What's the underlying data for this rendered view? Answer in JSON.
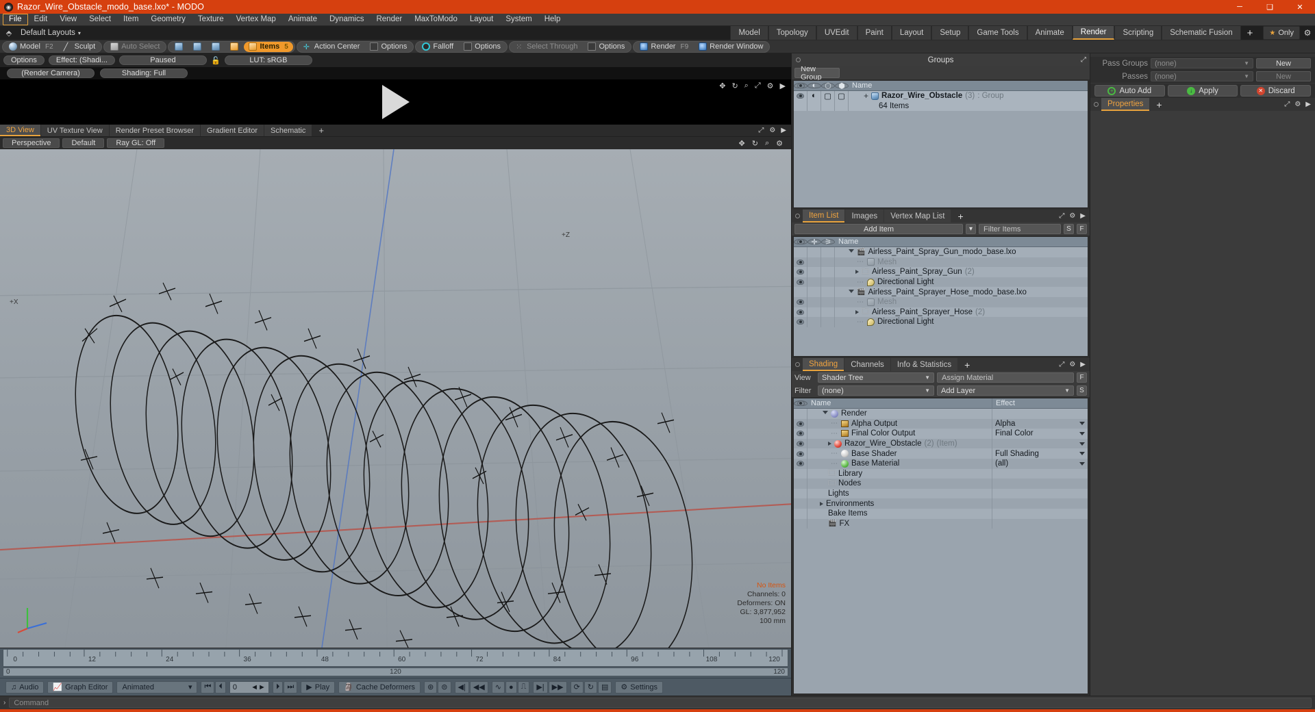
{
  "window": {
    "title": "Razor_Wire_Obstacle_modo_base.lxo* - MODO",
    "minimize": "─",
    "maximize": "❑",
    "close": "✕"
  },
  "menubar": {
    "items": [
      "File",
      "Edit",
      "View",
      "Select",
      "Item",
      "Geometry",
      "Texture",
      "Vertex Map",
      "Animate",
      "Dynamics",
      "Render",
      "MaxToModo",
      "Layout",
      "System",
      "Help"
    ],
    "active": "File"
  },
  "layout_row": {
    "layout_name": "Default Layouts",
    "caret": "▾",
    "tabs": [
      "Model",
      "Topology",
      "UVEdit",
      "Paint",
      "Layout",
      "Setup",
      "Game Tools",
      "Animate",
      "Render",
      "Scripting",
      "Schematic Fusion"
    ],
    "selected_tab": "Render",
    "add_tab": "+",
    "only_label": "Only",
    "star": "★"
  },
  "toolbar": {
    "mode_group": [
      {
        "label": "Model",
        "hotkey": "F2",
        "icon": "sphere-icon"
      },
      {
        "label": "Sculpt",
        "hotkey": "",
        "icon": "pen-icon"
      }
    ],
    "auto_select": "Auto Select",
    "select_modes": [
      "vertex-select-icon",
      "edge-select-icon",
      "polygon-select-icon",
      "material-select-icon"
    ],
    "items_label": "Items",
    "items_hotkey": "5",
    "action_center": "Action Center",
    "options1": "Options",
    "falloff": "Falloff",
    "options2": "Options",
    "select_through": "Select Through",
    "options3": "Options",
    "render": "Render",
    "render_hotkey": "F9",
    "render_window": "Render Window"
  },
  "preview": {
    "options": "Options",
    "effect": "Effect: (Shadi...",
    "paused": "Paused",
    "lut": "LUT: sRGB",
    "camera": "(Render Camera)",
    "shading": "Shading: Full",
    "icons": [
      "move-icon",
      "rotate-icon",
      "zoom-icon",
      "fit-icon",
      "gear-icon",
      "play-icon"
    ]
  },
  "viewport": {
    "tabs": [
      "3D View",
      "UV Texture View",
      "Render Preset Browser",
      "Gradient Editor",
      "Schematic"
    ],
    "selected_tab": "3D View",
    "add_tab": "+",
    "buttons": [
      "Perspective",
      "Default",
      "Ray GL: Off"
    ],
    "icons": [
      "move-icon",
      "rotate-icon",
      "zoom-icon",
      "gear-icon"
    ],
    "hud": {
      "no_items": "No Items",
      "channels": "Channels: 0",
      "deformers": "Deformers: ON",
      "gl": "GL: 3,877,952",
      "scale": "100 mm"
    },
    "axis_labels": {
      "plus_z": "+Z",
      "plus_x": "+X"
    }
  },
  "timeline": {
    "ticks": [
      "0",
      "12",
      "24",
      "36",
      "48",
      "60",
      "72",
      "84",
      "96",
      "108",
      "120"
    ],
    "range_start": "0",
    "range_mid": "120",
    "range_end": "120"
  },
  "bottombar": {
    "audio": "Audio",
    "graph_editor": "Graph Editor",
    "animated": "Animated",
    "caret": "▾",
    "frame_value": "0",
    "play": "Play",
    "cache_deformers": "Cache Deformers",
    "settings": "Settings",
    "transport": [
      "⏮",
      "⏴",
      "⏵",
      "⏭"
    ]
  },
  "groups_panel": {
    "title": "Groups",
    "new_group_button": "New Group",
    "columns": [
      "eye-icon",
      "shade-icon",
      "lock-icon",
      "render-icon",
      "Name"
    ],
    "rows": [
      {
        "name": "Razor_Wire_Obstacle",
        "count": "(3)",
        "type": ": Group",
        "sub": "64 Items"
      }
    ]
  },
  "item_list_panel": {
    "tabs": [
      "Item List",
      "Images",
      "Vertex Map List"
    ],
    "selected_tab": "Item List",
    "add_tab": "+",
    "add_item": "Add Item",
    "filter_placeholder": "Filter Items",
    "btn_s": "S",
    "btn_f": "F",
    "columns": [
      "eye-icon",
      "lock-icon",
      "axis-icon",
      "Name"
    ],
    "rows": [
      {
        "indent": 0,
        "name": "Airless_Paint_Spray_Gun_modo_base.lxo",
        "icon": "scene-icon",
        "tri": "down",
        "eye": false,
        "count": ""
      },
      {
        "indent": 1,
        "name": "Mesh",
        "icon": "mesh-icon",
        "tri": "",
        "eye": true,
        "count": "",
        "dim": true
      },
      {
        "indent": 1,
        "name": "Airless_Paint_Spray_Gun",
        "icon": "folder-icon",
        "tri": "right",
        "eye": true,
        "count": "(2)"
      },
      {
        "indent": 1,
        "name": "Directional Light",
        "icon": "light-icon",
        "tri": "",
        "eye": true,
        "count": ""
      },
      {
        "indent": 0,
        "name": "Airless_Paint_Sprayer_Hose_modo_base.lxo",
        "icon": "scene-icon",
        "tri": "down",
        "eye": false,
        "count": ""
      },
      {
        "indent": 1,
        "name": "Mesh",
        "icon": "mesh-icon",
        "tri": "",
        "eye": true,
        "count": "",
        "dim": true
      },
      {
        "indent": 1,
        "name": "Airless_Paint_Sprayer_Hose",
        "icon": "folder-icon",
        "tri": "right",
        "eye": true,
        "count": "(2)"
      },
      {
        "indent": 1,
        "name": "Directional Light",
        "icon": "light-icon",
        "tri": "",
        "eye": true,
        "count": ""
      }
    ]
  },
  "shading_panel": {
    "tabs": [
      "Shading",
      "Channels",
      "Info & Statistics"
    ],
    "selected_tab": "Shading",
    "add_tab": "+",
    "view_label": "View",
    "view_value": "Shader Tree",
    "assign_material": "Assign Material",
    "filter_label": "Filter",
    "filter_value": "(none)",
    "add_layer": "Add Layer",
    "btn_f": "F",
    "btn_s": "S",
    "columns": [
      "eye-icon",
      "Name",
      "Effect"
    ],
    "rows": [
      {
        "indent": 0,
        "name": "Render",
        "icon": "render-ball-icon",
        "tri": "down",
        "eye": false,
        "effect": ""
      },
      {
        "indent": 1,
        "name": "Alpha Output",
        "icon": "image-icon",
        "tri": "",
        "eye": true,
        "effect": "Alpha"
      },
      {
        "indent": 1,
        "name": "Final Color Output",
        "icon": "image-icon",
        "tri": "",
        "eye": true,
        "effect": "Final Color"
      },
      {
        "indent": 1,
        "name": "Razor_Wire_Obstacle",
        "count": "(2)",
        "suffix": "(Item)",
        "icon": "red-ball-icon",
        "tri": "right",
        "eye": true,
        "effect": ""
      },
      {
        "indent": 1,
        "name": "Base Shader",
        "icon": "white-ball-icon",
        "tri": "",
        "eye": true,
        "effect": "Full Shading"
      },
      {
        "indent": 1,
        "name": "Base Material",
        "icon": "green-ball-icon",
        "tri": "",
        "eye": true,
        "effect": "(all)"
      },
      {
        "indent": 1,
        "name": "Library",
        "icon": "folder-icon",
        "tri": "",
        "eye": false,
        "effect": ""
      },
      {
        "indent": 1,
        "name": "Nodes",
        "icon": "folder-icon",
        "tri": "",
        "eye": false,
        "effect": ""
      },
      {
        "indent": 1,
        "name": "Lights",
        "icon": "",
        "tri": "",
        "eye": false,
        "effect": ""
      },
      {
        "indent": 0,
        "name": "Environments",
        "icon": "",
        "tri": "right",
        "eye": false,
        "effect": ""
      },
      {
        "indent": 1,
        "name": "Bake Items",
        "icon": "",
        "tri": "",
        "eye": false,
        "effect": ""
      },
      {
        "indent": 1,
        "name": "FX",
        "icon": "fx-icon",
        "tri": "",
        "eye": false,
        "effect": ""
      }
    ]
  },
  "passes_panel": {
    "pass_groups_label": "Pass Groups",
    "pass_groups_value": "(none)",
    "pass_groups_new": "New",
    "passes_label": "Passes",
    "passes_value": "(none)",
    "passes_new": "New",
    "auto_add": "Auto Add",
    "apply": "Apply",
    "discard": "Discard"
  },
  "properties_panel": {
    "tabs": [
      "Properties"
    ],
    "selected_tab": "Properties",
    "add_tab": "+"
  },
  "command_bar": {
    "prompt": "›",
    "placeholder": "Command"
  },
  "colors": {
    "accent_orange": "#d6400f",
    "tab_orange": "#e8a33d",
    "panel_bg": "#3b3b3b",
    "tree_bg": "#9aa4ae"
  }
}
